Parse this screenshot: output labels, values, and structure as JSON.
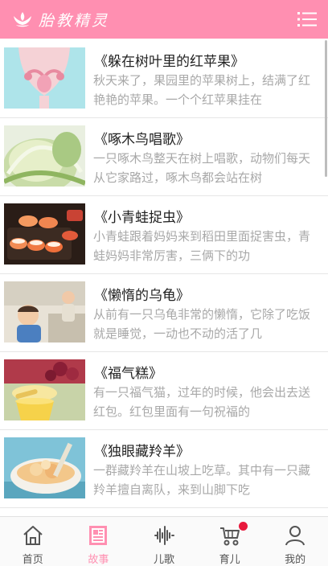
{
  "header": {
    "app_title": "胎教精灵",
    "logo_icon": "lotus-hands-icon",
    "menu_icon": "list-menu-icon"
  },
  "colors": {
    "brand": "#ff8fb1",
    "badge": "#e8193c",
    "excerpt": "#a8a8a8"
  },
  "stories": [
    {
      "title": "《躲在树叶里的红苹果》",
      "excerpt": "秋天来了，果园里的苹果树上，结满了红艳艳的苹果。一个个红苹果挂在",
      "thumb": "uterus-illustration"
    },
    {
      "title": "《啄木鸟唱歌》",
      "excerpt": "一只啄木鸟整天在树上唱歌，动物们每天从它家路过，啄木鸟都会站在树",
      "thumb": "cabbage-photo"
    },
    {
      "title": "《小青蛙捉虫》",
      "excerpt": "小青蛙跟着妈妈来到稻田里面捉害虫，青蛙妈妈非常厉害，三俩下的功",
      "thumb": "sushi-photo"
    },
    {
      "title": "《懒惰的乌龟》",
      "excerpt": "从前有一只乌龟非常的懒惰，它除了吃饭就是睡觉，一动也不动的活了几",
      "thumb": "child-photo"
    },
    {
      "title": "《福气糕》",
      "excerpt": "有一只福气猫，过年的时候，他会出去送红包。红包里面有一句祝福的",
      "thumb": "honey-photo"
    },
    {
      "title": "《独眼藏羚羊》",
      "excerpt": "一群藏羚羊在山坡上吃草。其中有一只藏羚羊擅自离队，来到山脚下吃",
      "thumb": "soup-photo"
    }
  ],
  "tabs": [
    {
      "label": "首页",
      "icon": "home-icon",
      "active": false
    },
    {
      "label": "故事",
      "icon": "story-book-icon",
      "active": true
    },
    {
      "label": "儿歌",
      "icon": "soundwave-icon",
      "active": false
    },
    {
      "label": "育儿",
      "icon": "stroller-icon",
      "active": false,
      "badge": true
    },
    {
      "label": "我的",
      "icon": "user-icon",
      "active": false
    }
  ]
}
